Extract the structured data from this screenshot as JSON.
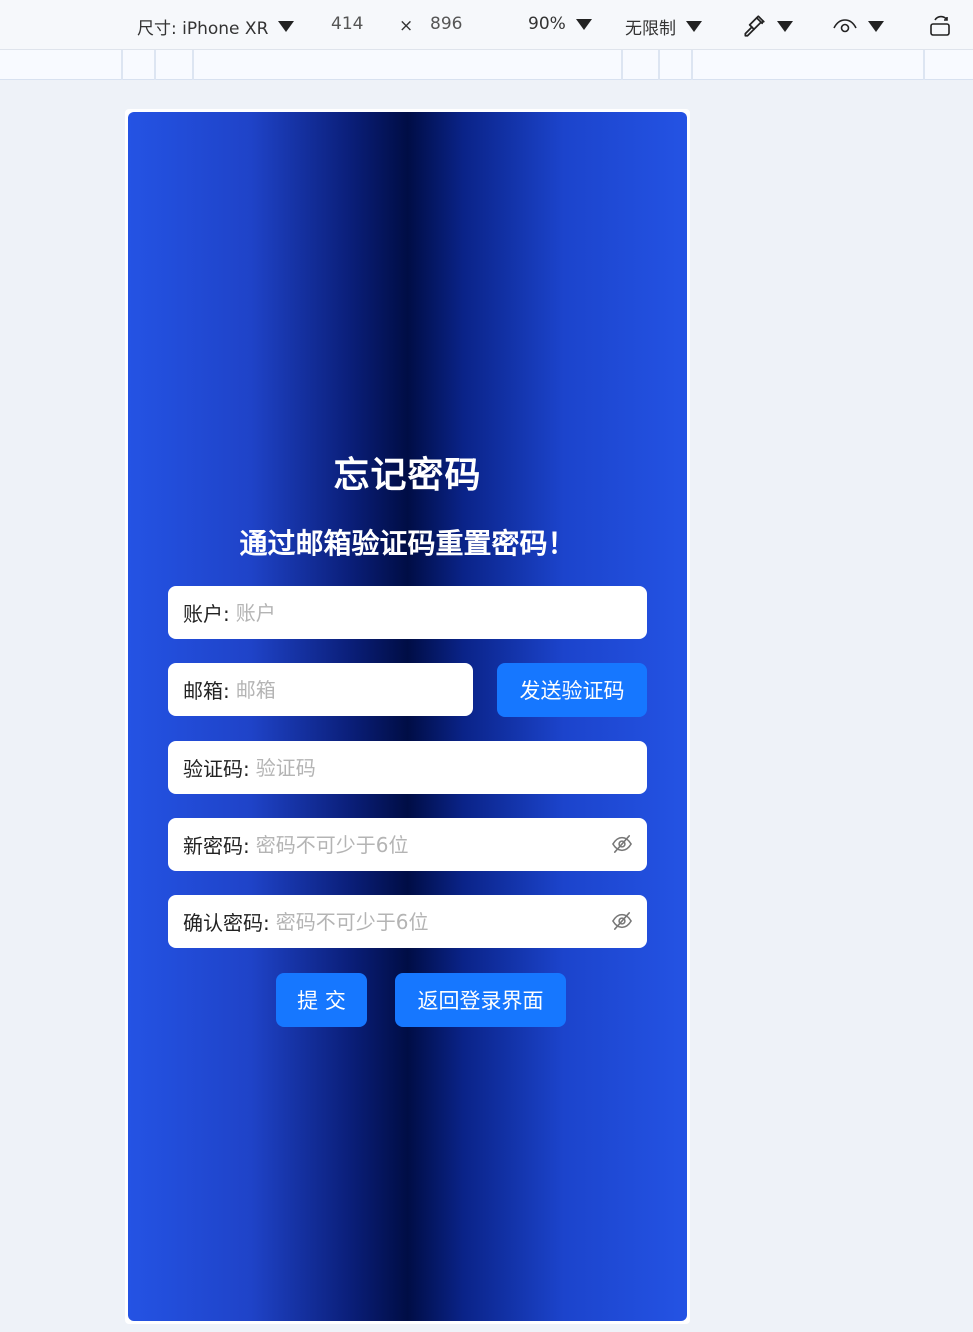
{
  "toolbar": {
    "size_label": "尺寸: iPhone XR",
    "width": "414",
    "times": "×",
    "height": "896",
    "zoom": "90%",
    "throttle": "无限制"
  },
  "form": {
    "title": "忘记密码",
    "subtitle": "通过邮箱验证码重置密码！",
    "account_label": "账户:",
    "account_placeholder": "账户",
    "email_label": "邮箱:",
    "email_placeholder": "邮箱",
    "send_code_label": "发送验证码",
    "code_label": "验证码:",
    "code_placeholder": "验证码",
    "new_password_label": "新密码:",
    "new_password_placeholder": "密码不可少于6位",
    "confirm_password_label": "确认密码:",
    "confirm_password_placeholder": "密码不可少于6位",
    "submit_label": "提 交",
    "back_label": "返回登录界面"
  },
  "icons": {
    "dropdown": "triangle-down-icon",
    "color_picker": "eyedropper-icon",
    "vision": "eye-icon",
    "rotate": "rotate-device-icon",
    "password_toggle": "eye-slash-icon"
  },
  "colors": {
    "primary_button": "#1677ff",
    "background_edge": "#2453e4",
    "background_center": "#000d45"
  }
}
